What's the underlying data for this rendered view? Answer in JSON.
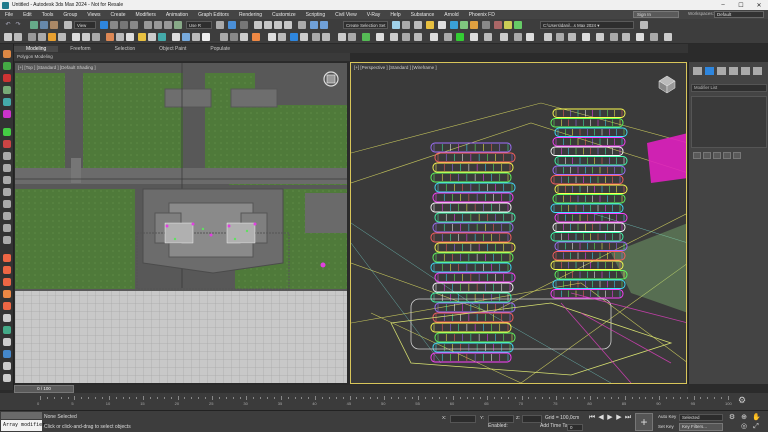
{
  "window": {
    "title": "Untitled - Autodesk 3ds Max 2024 - Not for Resale",
    "controls": [
      "–",
      "☐",
      "✕"
    ]
  },
  "menu": {
    "items": [
      "File",
      "Edit",
      "Tools",
      "Group",
      "Views",
      "Create",
      "Modifiers",
      "Animation",
      "Graph Editors",
      "Rendering",
      "Customize",
      "Scripting",
      "Civil View",
      "V-Ray",
      "Help",
      "Substance",
      "Arnold",
      "Phoenix FD"
    ],
    "sign_in": "Sign In",
    "workspaces_label": "Workspaces:",
    "workspace_value": "Default"
  },
  "toolbar": {
    "selection_filter": "View",
    "selection_set": "Create Selection Set",
    "project_path": "C:\\Users\\dani\\...s Max 2024 ▾",
    "view_filter": "Use R"
  },
  "ribbon": {
    "tabs": [
      "Modeling",
      "Freeform",
      "Selection",
      "Object Paint",
      "Populate"
    ],
    "active_tab": "Modeling",
    "sub_label": "Polygon Modeling"
  },
  "viewports": {
    "left_label": "[+] [Top ] [Standard ] [Default Shading ]",
    "right_label": "[+] [Perspective ] [Standard ] [Wireframe ]"
  },
  "command_panel": {
    "name_field": "Modifier List"
  },
  "timeline": {
    "slider_text": "0 / 100",
    "ticks": [
      "0",
      "5",
      "10",
      "15",
      "20",
      "25",
      "30",
      "35",
      "40",
      "45",
      "50",
      "55",
      "60",
      "65",
      "70",
      "75",
      "80",
      "85",
      "90",
      "95",
      "100"
    ]
  },
  "status": {
    "maxscript_text": "Array modifier",
    "selection": "None Selected",
    "prompt": "Click or click-and-drag to select objects",
    "x_label": "X:",
    "y_label": "Y:",
    "z_label": "Z:",
    "grid": "Grid = 100,0cm",
    "enabled": "Enabled:",
    "add_time_tag": "Add Time Tag",
    "frame": "0",
    "auto_key": "Auto Key",
    "set_key": "Set Key",
    "selected": "Selected",
    "key_filters": "Key Filters..."
  },
  "colors": {
    "accent_viewport_border": "#d8c55a",
    "maxscript_bg": "#f2f2f2"
  }
}
